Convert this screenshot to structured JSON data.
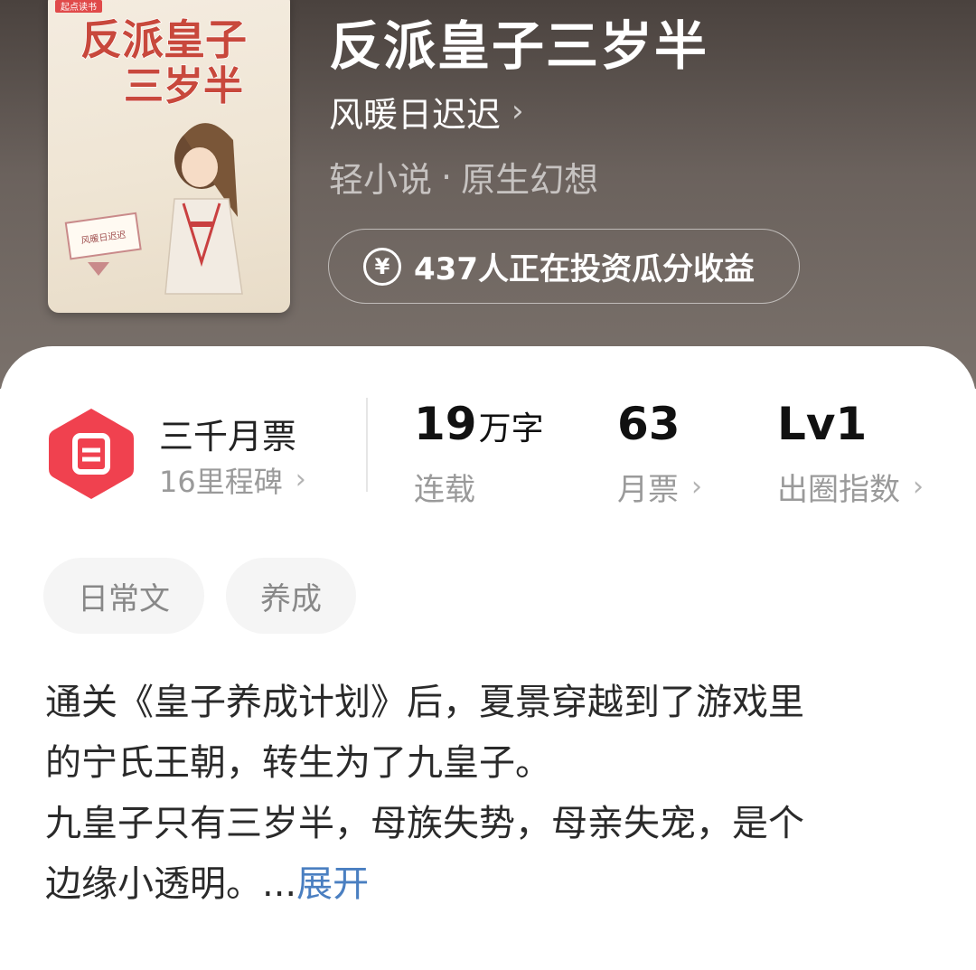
{
  "book": {
    "title": "反派皇子三岁半",
    "author": "风暖日迟迟",
    "category": "轻小说",
    "separator": "·",
    "subcategory": "原生幻想",
    "invest_text": "437人正在投资瓜分收益",
    "cover": {
      "publisher_badge": "起点读书",
      "title_line1": "反派皇子",
      "title_line2": "三岁半",
      "sign_text": "风暖日迟迟"
    }
  },
  "stats": {
    "ticket_title": "三千月票",
    "ticket_sub": "16里程碑",
    "word_count": {
      "value": "19",
      "unit": "万字",
      "label": "连载"
    },
    "monthly_tickets": {
      "value": "63",
      "label": "月票"
    },
    "popularity": {
      "value": "Lv1",
      "label": "出圈指数"
    }
  },
  "tags": [
    "日常文",
    "养成"
  ],
  "synopsis": {
    "lines": [
      "通关《皇子养成计划》后，夏景穿越到了游戏里",
      "的宁氏王朝，转生为了九皇子。",
      "九皇子只有三岁半，母族失势，母亲失宠，是个",
      "边缘小透明。..."
    ],
    "expand_label": "展开"
  },
  "colors": {
    "header_bg": "#5e5651",
    "ticket_red": "#f0414f",
    "expand_link": "#4a7fc1"
  },
  "icons": [
    "chevron-right-icon",
    "yen-coin-icon",
    "ticket-badge-icon"
  ]
}
